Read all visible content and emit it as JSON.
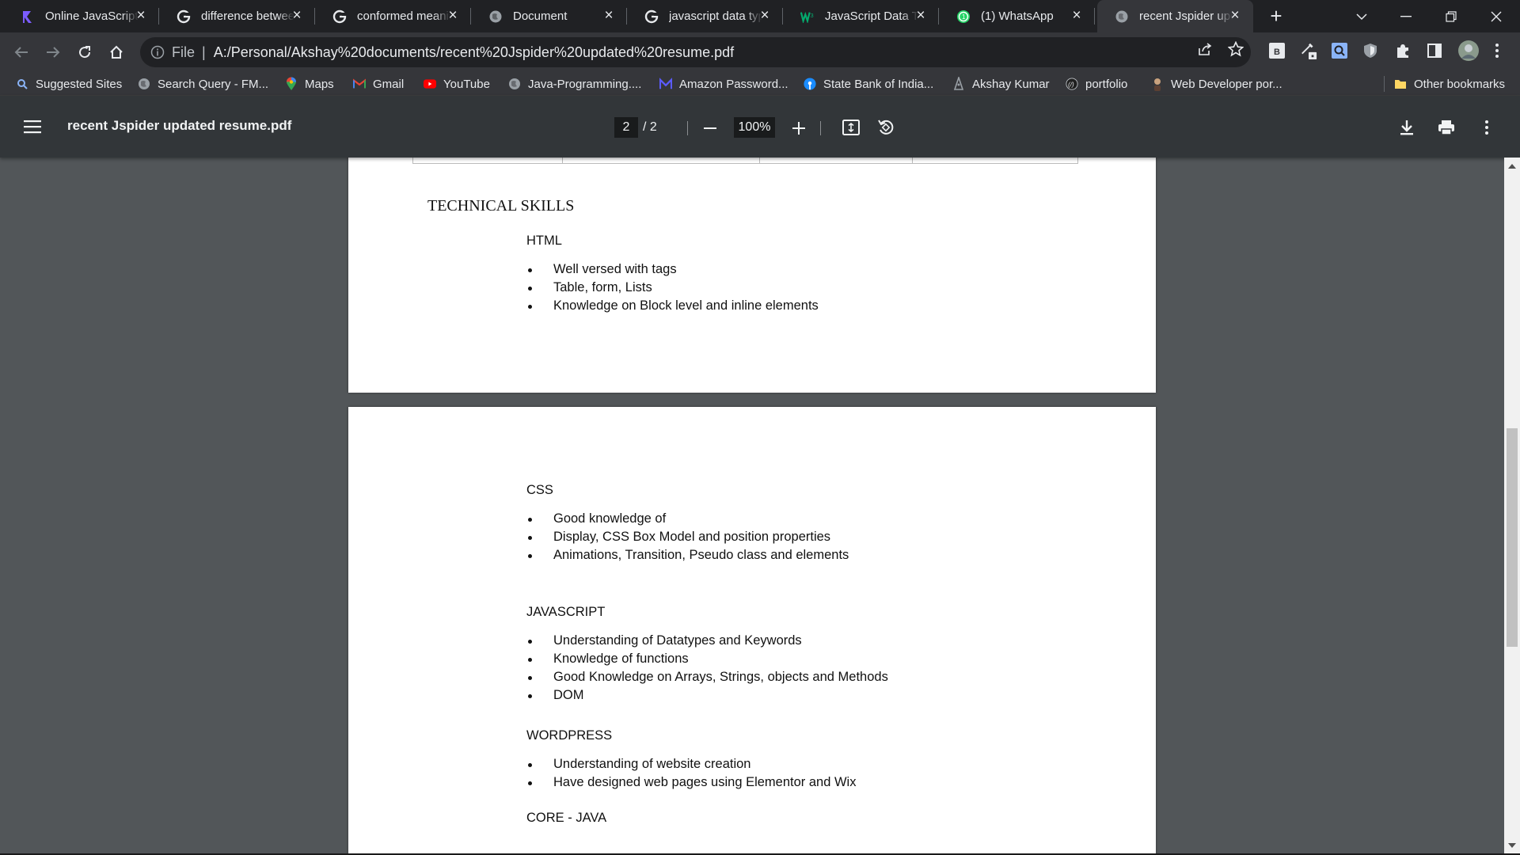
{
  "tabs": [
    {
      "title": "Online JavaScript",
      "icon": "replit-icon"
    },
    {
      "title": "difference between",
      "icon": "google-icon"
    },
    {
      "title": "conformed meaning",
      "icon": "google-icon"
    },
    {
      "title": "Document",
      "icon": "globe-icon"
    },
    {
      "title": "javascript data types",
      "icon": "google-icon"
    },
    {
      "title": "JavaScript Data Types",
      "icon": "w3schools-icon"
    },
    {
      "title": "(1) WhatsApp",
      "icon": "whatsapp-icon"
    },
    {
      "title": "recent Jspider updated resume.pdf",
      "icon": "globe-icon",
      "active": true
    }
  ],
  "toolbar": {
    "scheme": "File",
    "url": "A:/Personal/Akshay%20documents/recent%20Jspider%20updated%20resume.pdf"
  },
  "bookmarks": [
    {
      "label": "Suggested Sites",
      "icon": "search-icon"
    },
    {
      "label": "Search Query - FM...",
      "icon": "globe-icon"
    },
    {
      "label": "Maps",
      "icon": "maps-pin-icon"
    },
    {
      "label": "Gmail",
      "icon": "gmail-icon"
    },
    {
      "label": "YouTube",
      "icon": "youtube-icon"
    },
    {
      "label": "Java-Programming....",
      "icon": "globe-icon"
    },
    {
      "label": "Amazon Password...",
      "icon": "m-icon"
    },
    {
      "label": "State Bank of India...",
      "icon": "sbi-icon"
    },
    {
      "label": "Akshay Kumar",
      "icon": "person-icon"
    },
    {
      "label": "portfolio",
      "icon": "code-icon"
    },
    {
      "label": "Web Developer por...",
      "icon": "avatar-icon"
    }
  ],
  "other_bookmarks": "Other bookmarks",
  "pdf": {
    "title": "recent Jspider updated resume.pdf",
    "page_current": "2",
    "page_total": "/  2",
    "zoom": "100%"
  },
  "doc": {
    "section_title": "TECHNICAL SKILLS",
    "html_heading": "HTML",
    "html_items": [
      "Well versed with tags",
      "Table, form, Lists",
      "Knowledge on Block level and inline elements"
    ],
    "css_heading": "CSS",
    "css_items": [
      "Good knowledge of",
      "Display, CSS Box Model and position properties",
      "Animations, Transition, Pseudo class and elements"
    ],
    "js_heading": "JAVASCRIPT",
    "js_items": [
      "Understanding of Datatypes and Keywords",
      "Knowledge of functions",
      "Good Knowledge on Arrays, Strings, objects and Methods",
      "DOM"
    ],
    "wp_heading": "WORDPRESS",
    "wp_items": [
      "Understanding of website creation",
      "Have designed web pages using Elementor and Wix"
    ],
    "java_heading": "CORE - JAVA"
  }
}
